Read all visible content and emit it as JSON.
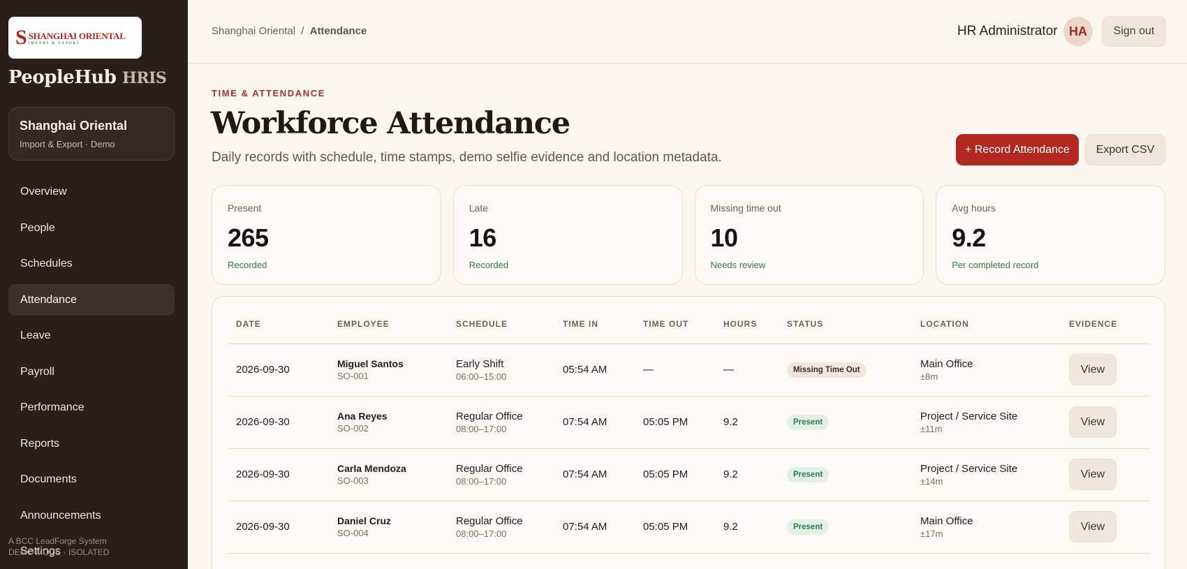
{
  "sidebar": {
    "logo": {
      "mark": "S",
      "name": "SHANGHAI ORIENTAL",
      "sub": "IMPORT & EXPORT"
    },
    "brand_main": "PeopleHub",
    "brand_suffix": "HRIS",
    "org_name": "Shanghai Oriental",
    "org_sub": "Import & Export · Demo",
    "items": [
      {
        "label": "Overview"
      },
      {
        "label": "People"
      },
      {
        "label": "Schedules"
      },
      {
        "label": "Attendance"
      },
      {
        "label": "Leave"
      },
      {
        "label": "Payroll"
      },
      {
        "label": "Performance"
      },
      {
        "label": "Reports"
      },
      {
        "label": "Documents"
      },
      {
        "label": "Announcements"
      },
      {
        "label": "Settings"
      }
    ],
    "active": "Attendance",
    "footer_line1": "A BCC LeadForge System",
    "footer_line2": "DEMO MODE · ISOLATED"
  },
  "header": {
    "breadcrumb_root": "Shanghai Oriental",
    "breadcrumb_sep": "/",
    "breadcrumb_current": "Attendance",
    "user_name": "HR Administrator",
    "avatar_initials": "HA",
    "signout_label": "Sign out"
  },
  "page": {
    "eyebrow": "TIME & ATTENDANCE",
    "title": "Workforce Attendance",
    "subtitle": "Daily records with schedule, time stamps, demo selfie evidence and location metadata.",
    "primary_action": "+ Record Attendance",
    "secondary_action": "Export CSV"
  },
  "stats": [
    {
      "label": "Present",
      "value": "265",
      "note": "Recorded"
    },
    {
      "label": "Late",
      "value": "16",
      "note": "Recorded"
    },
    {
      "label": "Missing time out",
      "value": "10",
      "note": "Needs review"
    },
    {
      "label": "Avg hours",
      "value": "9.2",
      "note": "Per completed record"
    }
  ],
  "table": {
    "columns": [
      "DATE",
      "EMPLOYEE",
      "SCHEDULE",
      "TIME IN",
      "TIME OUT",
      "HOURS",
      "STATUS",
      "LOCATION",
      "EVIDENCE"
    ],
    "rows": [
      {
        "date": "2026-09-30",
        "name": "Miguel Santos",
        "id": "SO-001",
        "schedule": "Early Shift",
        "hours_range": "06:00–15:00",
        "time_in": "05:54 AM",
        "time_out": "—",
        "hours": "—",
        "status": "Missing Time Out",
        "location": "Main Office",
        "accuracy": "±8m",
        "evidence": "View"
      },
      {
        "date": "2026-09-30",
        "name": "Ana Reyes",
        "id": "SO-002",
        "schedule": "Regular Office",
        "hours_range": "08:00–17:00",
        "time_in": "07:54 AM",
        "time_out": "05:05 PM",
        "hours": "9.2",
        "status": "Present",
        "location": "Project / Service Site",
        "accuracy": "±11m",
        "evidence": "View"
      },
      {
        "date": "2026-09-30",
        "name": "Carla Mendoza",
        "id": "SO-003",
        "schedule": "Regular Office",
        "hours_range": "08:00–17:00",
        "time_in": "07:54 AM",
        "time_out": "05:05 PM",
        "hours": "9.2",
        "status": "Present",
        "location": "Project / Service Site",
        "accuracy": "±14m",
        "evidence": "View"
      },
      {
        "date": "2026-09-30",
        "name": "Daniel Cruz",
        "id": "SO-004",
        "schedule": "Regular Office",
        "hours_range": "08:00–17:00",
        "time_in": "07:54 AM",
        "time_out": "05:05 PM",
        "hours": "9.2",
        "status": "Present",
        "location": "Main Office",
        "accuracy": "±17m",
        "evidence": "View"
      }
    ]
  },
  "colors": {
    "accent": "#b0281f",
    "sidebar_bg": "#2a1e1a",
    "page_bg": "#fbf6f0",
    "positive": "#2f7c53"
  }
}
